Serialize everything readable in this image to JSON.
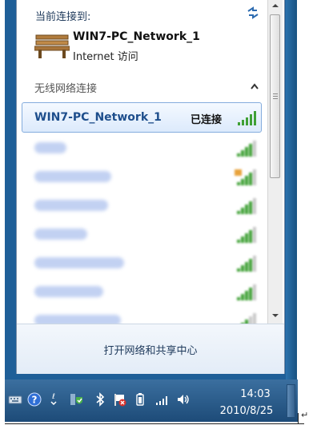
{
  "flyout": {
    "header_label": "当前连接到:",
    "current": {
      "name": "WIN7-PC_Network_1",
      "access": "Internet 访问"
    },
    "section_label": "无线网络连接",
    "selected": {
      "name": "WIN7-PC_Network_1",
      "status": "已连接",
      "signal_bars": 5
    },
    "networks": [
      {
        "name": "I3A5",
        "signal_bars": 4,
        "secured": false
      },
      {
        "name": "TP-LINK_11936",
        "signal_bars": 4,
        "secured": true
      },
      {
        "name": "vodfonsion01",
        "signal_bars": 4,
        "secured": false
      },
      {
        "name": "WIFI2016",
        "signal_bars": 4,
        "secured": false
      },
      {
        "name": "ChinaNet-2899",
        "signal_bars": 4,
        "secured": false
      },
      {
        "name": "TP-LINK-2D208",
        "signal_bars": 4,
        "secured": false
      },
      {
        "name": "WIN7-PC_Network",
        "signal_bars": 3,
        "secured": false
      }
    ],
    "footer_link": "打开网络和共享中心"
  },
  "taskbar": {
    "time": "14:03",
    "date": "2010/8/25"
  },
  "colors": {
    "accent": "#1e4e8c",
    "signal": "#3fa035",
    "frame": "#1f5f98"
  }
}
